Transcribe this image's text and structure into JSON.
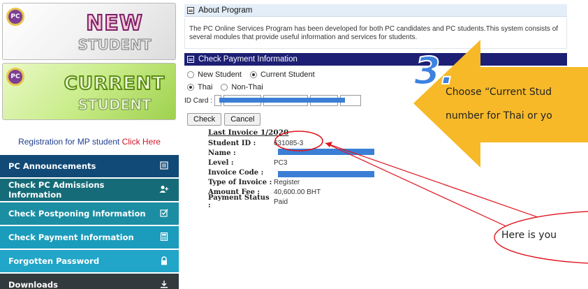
{
  "sidebar": {
    "new_banner": {
      "logo": "PC",
      "title": "NEW",
      "subtitle": "STUDENT"
    },
    "current_banner": {
      "logo": "PC",
      "title": "CURRENT",
      "subtitle": "STUDENT"
    },
    "mp_registration": {
      "text": "Registration for MP student",
      "link": "Click Here"
    },
    "menu": [
      {
        "label": "PC Announcements",
        "icon": "document-list-icon"
      },
      {
        "label": "Check PC Admissions Information",
        "icon": "user-add-icon"
      },
      {
        "label": "Check Postponing Information",
        "icon": "edit-check-icon"
      },
      {
        "label": "Check Payment Information",
        "icon": "calculator-icon"
      },
      {
        "label": "Forgotten Password",
        "icon": "lock-icon"
      },
      {
        "label": "Downloads",
        "icon": "download-icon"
      }
    ]
  },
  "about": {
    "title": "About Program",
    "body": "The PC Online Services Program has been developed for both PC candidates and PC students.This system consists of several modules that provide useful information and services for students."
  },
  "payment": {
    "title": "Check Payment Information",
    "student_type": {
      "options": [
        "New Student",
        "Current Student"
      ],
      "selected": "Current Student"
    },
    "nationality": {
      "options": [
        "Thai",
        "Non-Thai"
      ],
      "selected": "Thai"
    },
    "id_card_label": "ID Card :",
    "buttons": {
      "check": "Check",
      "cancel": "Cancel"
    },
    "invoice": {
      "title": "Last Invoice 1/2020",
      "rows": [
        {
          "key": "Student ID :",
          "value": "631085-3"
        },
        {
          "key": "Name :",
          "value": ""
        },
        {
          "key": "Level :",
          "value": "PC3"
        },
        {
          "key": "Invoice Code :",
          "value": ""
        },
        {
          "key": "Type of Invoice :",
          "value": "Register"
        },
        {
          "key": "Amount Fee :",
          "value": "40,600.00 BHT"
        },
        {
          "key": "Payment Status :",
          "value": "Paid"
        }
      ]
    }
  },
  "annotations": {
    "step_number": "3.",
    "arrow_line1": "Choose “Current Stud",
    "arrow_line2": "number for Thai or yo",
    "bubble_text": "Here is you",
    "colors": {
      "arrow": "#f7b928",
      "step": "#3e82e0",
      "circle": "#e0141e",
      "mask": "#3a7fd5"
    }
  }
}
